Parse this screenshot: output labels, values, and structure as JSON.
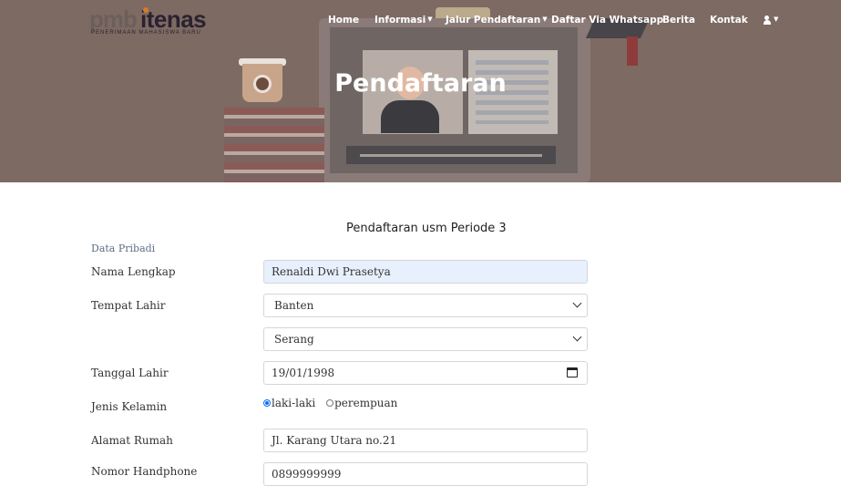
{
  "brand": {
    "logo_pmb": "pmb",
    "logo_itenas": "itenas",
    "logo_subtitle": "PENERIMAAN MAHASISWA BARU"
  },
  "nav": {
    "home": "Home",
    "informasi": "Informasi",
    "jalur": "Jalur Pendaftaran",
    "whatsapp": "Daftar Via Whatsapp",
    "berita": "Berita",
    "kontak": "Kontak",
    "account_icon": "user-icon"
  },
  "hero": {
    "title": "Pendaftaran"
  },
  "form": {
    "title": "Pendaftaran usm Periode 3",
    "section": "Data Pribadi",
    "labels": {
      "nama": "Nama Lengkap",
      "tempat": "Tempat Lahir",
      "tanggal": "Tanggal Lahir",
      "kelamin": "Jenis Kelamin",
      "alamat": "Alamat Rumah",
      "hp": "Nomor Handphone"
    },
    "values": {
      "nama": "Renaldi Dwi Prasetya",
      "provinsi": "Banten",
      "kota": "Serang",
      "tanggal": "19/01/1998",
      "alamat": "Jl. Karang Utara no.21",
      "hp": "0899999999"
    },
    "gender": {
      "option1": "laki-laki",
      "option2": "perempuan",
      "selected": "laki-laki"
    }
  },
  "colors": {
    "hero_overlay": "#7d6a63",
    "field_autofill": "#e8f0fe",
    "radio_accent": "#0d6efd",
    "logo_accent": "#d97b27"
  }
}
